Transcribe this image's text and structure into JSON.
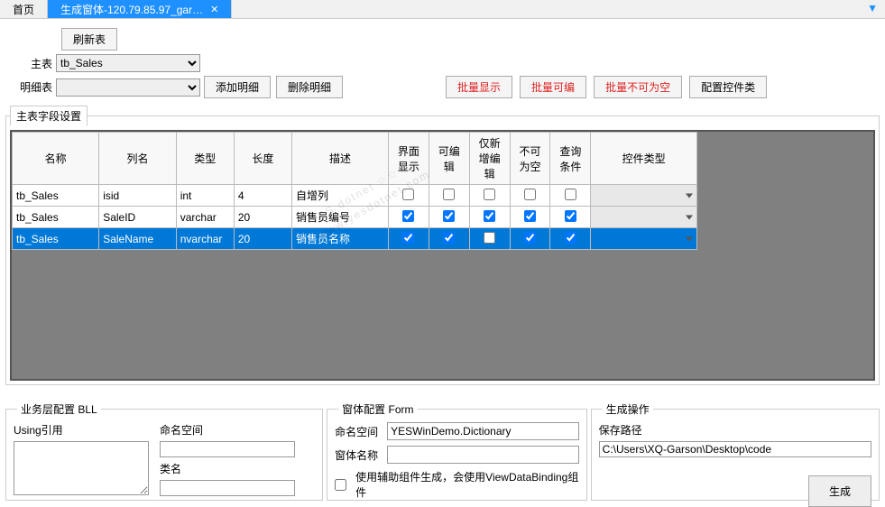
{
  "tabs": {
    "home": "首页",
    "active": "生成窗体-120.79.85.97_gar…"
  },
  "toolbar": {
    "refresh": "刷新表",
    "mainTableLabel": "主表",
    "mainTableValue": "tb_Sales",
    "detailTableLabel": "明细表",
    "addDetail": "添加明细",
    "deleteDetail": "删除明细",
    "batchShow": "批量显示",
    "batchEdit": "批量可编",
    "batchNotNull": "批量不可为空",
    "configControl": "配置控件类"
  },
  "fieldset": {
    "legend": "主表字段设置"
  },
  "headers": {
    "name": "名称",
    "col": "列名",
    "type": "类型",
    "len": "长度",
    "desc": "描述",
    "show": "界面显示",
    "edit": "可编辑",
    "newEdit": "仅新增编辑",
    "notNull": "不可为空",
    "query": "查询条件",
    "ctrl": "控件类型"
  },
  "rows": [
    {
      "name": "tb_Sales",
      "col": "isid",
      "type": "int",
      "len": "4",
      "desc": "自增列",
      "show": false,
      "edit": false,
      "newEdit": false,
      "notNull": false,
      "query": false
    },
    {
      "name": "tb_Sales",
      "col": "SaleID",
      "type": "varchar",
      "len": "20",
      "desc": "销售员编号",
      "show": true,
      "edit": true,
      "newEdit": true,
      "notNull": true,
      "query": true
    },
    {
      "name": "tb_Sales",
      "col": "SaleName",
      "type": "nvarchar",
      "len": "20",
      "desc": "销售员名称",
      "show": true,
      "edit": true,
      "newEdit": false,
      "notNull": true,
      "query": true
    }
  ],
  "bll": {
    "legend": "业务层配置 BLL",
    "using": "Using引用",
    "ns": "命名空间",
    "cls": "类名"
  },
  "form": {
    "legend": "窗体配置 Form",
    "nsLabel": "命名空间",
    "nsValue": "YESWinDemo.Dictionary",
    "nameLabel": "窗体名称",
    "helperLabel": "使用辅助组件生成，会使用ViewDataBinding组件"
  },
  "gen": {
    "legend": "生成操作",
    "pathLabel": "保存路径",
    "pathValue": "C:\\Users\\XQ-Garson\\Desktop\\code",
    "btn": "生成"
  },
  "watermark": {
    "l1": "YES dotnet ☆☆☆",
    "l2": "www.yesdotnet.com"
  }
}
